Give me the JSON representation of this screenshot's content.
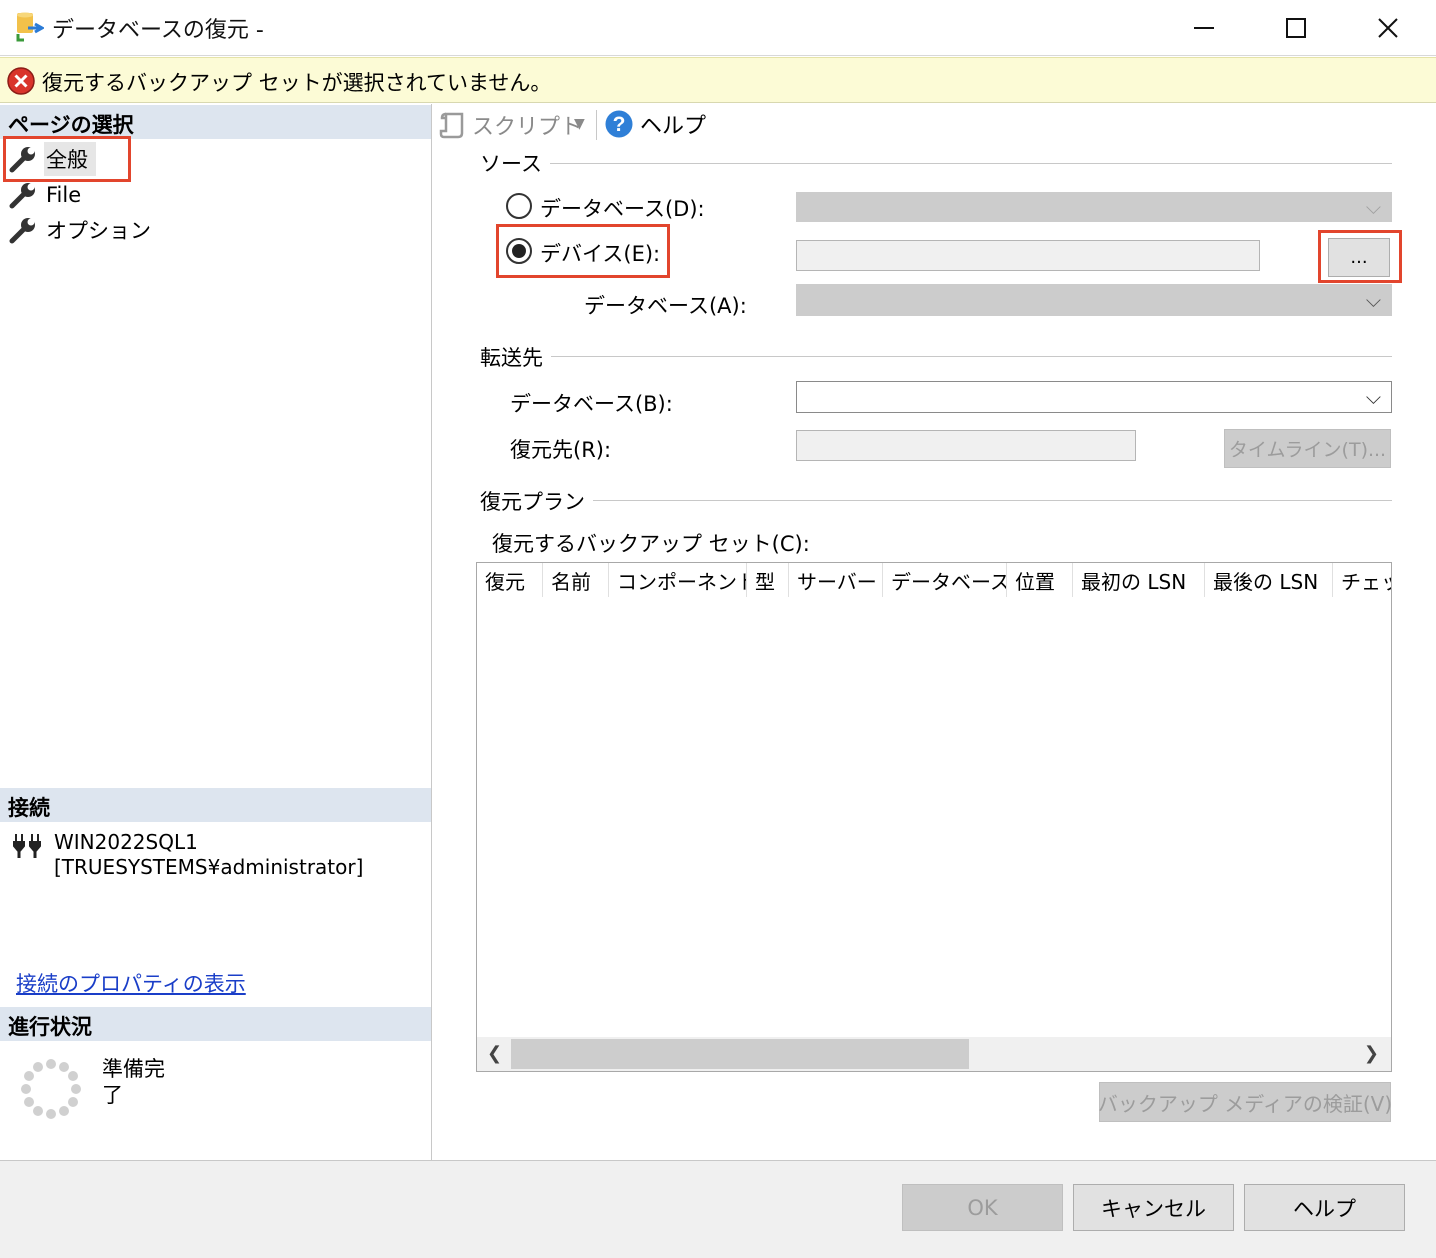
{
  "window": {
    "title": "データベースの復元 -"
  },
  "warning": {
    "message": "復元するバックアップ セットが選択されていません。"
  },
  "left_panel": {
    "page_select_header": "ページの選択",
    "pages": [
      {
        "label": "全般",
        "icon": "wrench-icon",
        "selected": true
      },
      {
        "label": "File",
        "icon": "wrench-icon"
      },
      {
        "label": "オプション",
        "icon": "wrench-icon"
      }
    ],
    "connection_header": "接続",
    "connection_server": "WIN2022SQL1",
    "connection_user": "[TRUESYSTEMS¥administrator]",
    "connection_link": "接続のプロパティの表示",
    "progress_header": "進行状況",
    "progress_status": "準備完了"
  },
  "toolbar": {
    "script_label": "スクリプト",
    "help_label": "ヘルプ"
  },
  "source": {
    "group_label": "ソース",
    "database_radio_label": "データベース(D):",
    "device_radio_label": "デバイス(E):",
    "selected_radio": "device",
    "browse_label": "...",
    "device_database_label": "データベース(A):"
  },
  "destination": {
    "group_label": "転送先",
    "database_label": "データベース(B):",
    "restore_to_label": "復元先(R):",
    "timeline_label": "タイムライン(T)..."
  },
  "restore_plan": {
    "group_label": "復元プラン",
    "backup_sets_label": "復元するバックアップ セット(C):",
    "columns": [
      "復元",
      "名前",
      "コンポーネント",
      "型",
      "サーバー",
      "データベース",
      "位置",
      "最初の LSN",
      "最後の LSN",
      "チェッ"
    ],
    "rows": [],
    "verify_label": "バックアップ メディアの検証(V)"
  },
  "footer": {
    "ok_label": "OK",
    "cancel_label": "キャンセル",
    "help_label": "ヘルプ"
  },
  "colors": {
    "highlight_box": "#e2452d",
    "warning_bg": "#fcfbd6",
    "section_header_bg": "#dde5ef",
    "link": "#1a3ec8"
  }
}
